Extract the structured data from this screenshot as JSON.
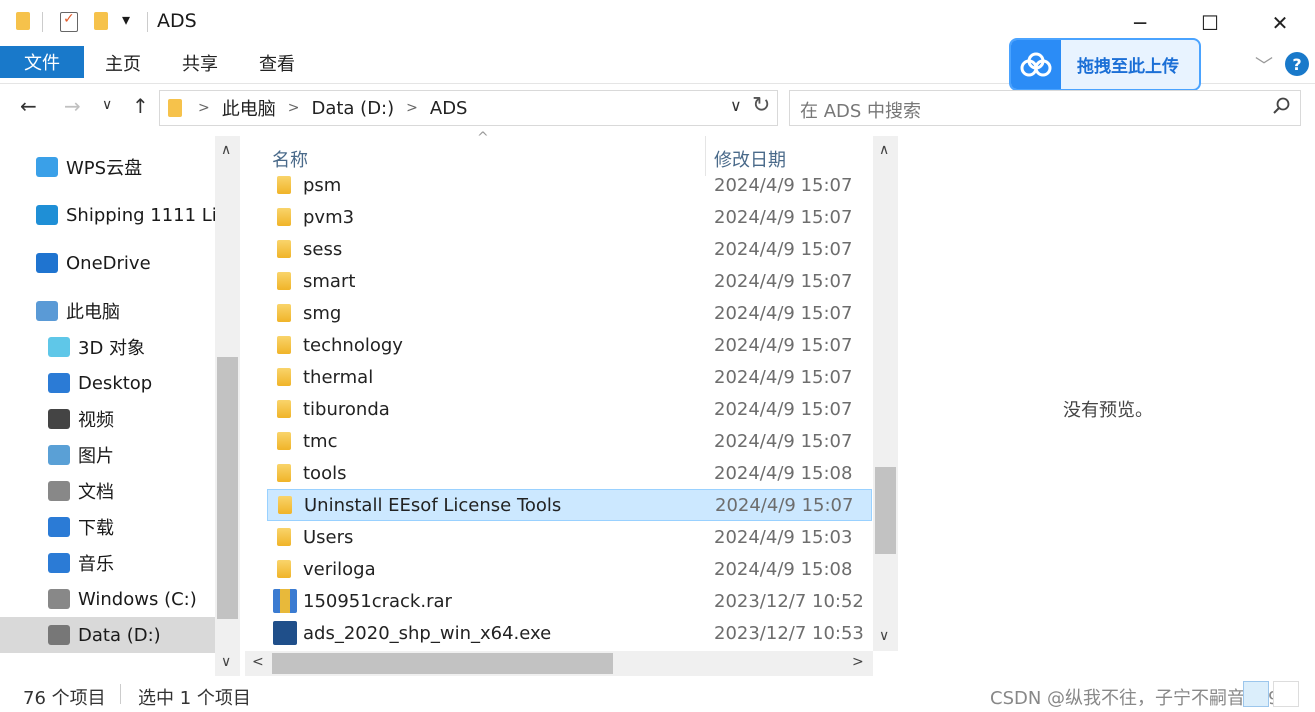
{
  "window": {
    "title": "ADS",
    "minimize_glyph": "─",
    "maximize_glyph": "☐",
    "close_glyph": "✕"
  },
  "quick_access": {
    "dropdown_glyph": "▾"
  },
  "ribbon": {
    "tabs": [
      {
        "label": "文件"
      },
      {
        "label": "主页"
      },
      {
        "label": "共享"
      },
      {
        "label": "查看"
      }
    ],
    "upload_button_label": "拖拽至此上传",
    "collapse_glyph": "﹀",
    "help_glyph": "?"
  },
  "navigation": {
    "back_glyph": "←",
    "forward_glyph": "→",
    "recent_glyph": "∨",
    "up_glyph": "↑",
    "breadcrumb": [
      "此电脑",
      "Data (D:)",
      "ADS"
    ],
    "breadcrumb_separator": ">",
    "dropdown_glyph": "∨",
    "refresh_glyph": "↻",
    "search_placeholder": "在 ADS 中搜索"
  },
  "nav_pane": {
    "items": [
      {
        "label": "WPS云盘",
        "icon": "wps-cloud-icon"
      },
      {
        "label": "Shipping 1111 Li",
        "icon": "shipping-icon"
      },
      {
        "label": "OneDrive",
        "icon": "onedrive-icon"
      },
      {
        "label": "此电脑",
        "icon": "computer-icon"
      },
      {
        "label": "3D 对象",
        "icon": "3d-objects-icon"
      },
      {
        "label": "Desktop",
        "icon": "desktop-icon"
      },
      {
        "label": "视频",
        "icon": "video-icon"
      },
      {
        "label": "图片",
        "icon": "pictures-icon"
      },
      {
        "label": "文档",
        "icon": "documents-icon"
      },
      {
        "label": "下载",
        "icon": "download-icon"
      },
      {
        "label": "音乐",
        "icon": "music-icon"
      },
      {
        "label": "Windows (C:)",
        "icon": "drive-c-icon"
      },
      {
        "label": "Data (D:)",
        "icon": "drive-d-icon",
        "selected": true
      }
    ],
    "scroll_up_glyph": "∧",
    "scroll_down_glyph": "∨"
  },
  "file_list": {
    "columns": {
      "name": "名称",
      "date": "修改日期"
    },
    "sort_glyph": "^",
    "rows": [
      {
        "name": "psm",
        "date": "2024/4/9 15:07",
        "type": "folder"
      },
      {
        "name": "pvm3",
        "date": "2024/4/9 15:07",
        "type": "folder"
      },
      {
        "name": "sess",
        "date": "2024/4/9 15:07",
        "type": "folder"
      },
      {
        "name": "smart",
        "date": "2024/4/9 15:07",
        "type": "folder"
      },
      {
        "name": "smg",
        "date": "2024/4/9 15:07",
        "type": "folder"
      },
      {
        "name": "technology",
        "date": "2024/4/9 15:07",
        "type": "folder"
      },
      {
        "name": "thermal",
        "date": "2024/4/9 15:07",
        "type": "folder"
      },
      {
        "name": "tiburonda",
        "date": "2024/4/9 15:07",
        "type": "folder"
      },
      {
        "name": "tmc",
        "date": "2024/4/9 15:07",
        "type": "folder"
      },
      {
        "name": "tools",
        "date": "2024/4/9 15:08",
        "type": "folder"
      },
      {
        "name": "Uninstall EEsof License Tools",
        "date": "2024/4/9 15:07",
        "type": "folder",
        "selected": true
      },
      {
        "name": "Users",
        "date": "2024/4/9 15:03",
        "type": "folder"
      },
      {
        "name": "veriloga",
        "date": "2024/4/9 15:08",
        "type": "folder"
      },
      {
        "name": "150951crack.rar",
        "date": "2023/12/7 10:52",
        "type": "rar"
      },
      {
        "name": "ads_2020_shp_win_x64.exe",
        "date": "2023/12/7 10:53",
        "type": "exe"
      }
    ],
    "scroll_up_glyph": "∧",
    "scroll_down_glyph": "∨",
    "scroll_left_glyph": "<",
    "scroll_right_glyph": ">"
  },
  "preview_pane": {
    "empty_text": "没有预览。"
  },
  "status_bar": {
    "item_count": "76 个项目",
    "selection": "选中 1 个项目"
  },
  "watermark": "CSDN @纵我不往，子宁不嗣音1995"
}
